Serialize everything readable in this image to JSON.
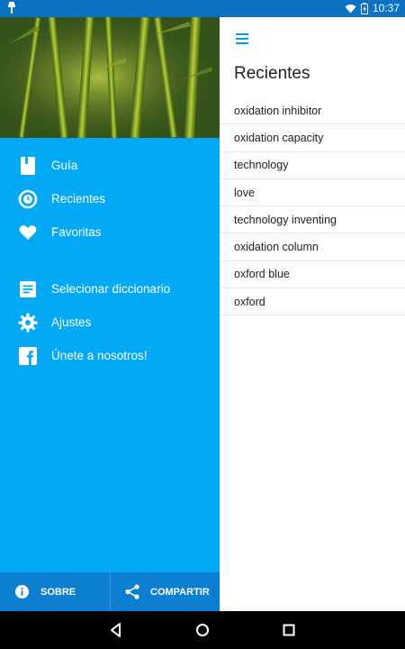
{
  "status_bar": {
    "time": "10:37"
  },
  "drawer": {
    "header_image": "bamboo-forest",
    "menu": [
      {
        "label": "Guía",
        "icon": "book-icon"
      },
      {
        "label": "Recientes",
        "icon": "history-icon"
      },
      {
        "label": "Favoritas",
        "icon": "heart-icon"
      },
      {
        "label": "Selecionar diccionario",
        "icon": "document-icon"
      },
      {
        "label": "Ajustes",
        "icon": "gear-icon"
      },
      {
        "label": "Únete a nosotros!",
        "icon": "facebook-icon"
      }
    ],
    "bottom": {
      "about_label": "SOBRE",
      "share_label": "COMPARTIR"
    }
  },
  "main": {
    "title": "Recientes",
    "items": [
      "oxidation inhibitor",
      "oxidation capacity",
      "technology",
      "love",
      "technology inventing",
      "oxidation column",
      "oxford blue",
      "oxford"
    ]
  },
  "colors": {
    "drawer_bg": "#03a9f4",
    "status_bar": "#0b72c4",
    "bottom_bar": "#0d7fd0",
    "accent": "#039be5"
  }
}
